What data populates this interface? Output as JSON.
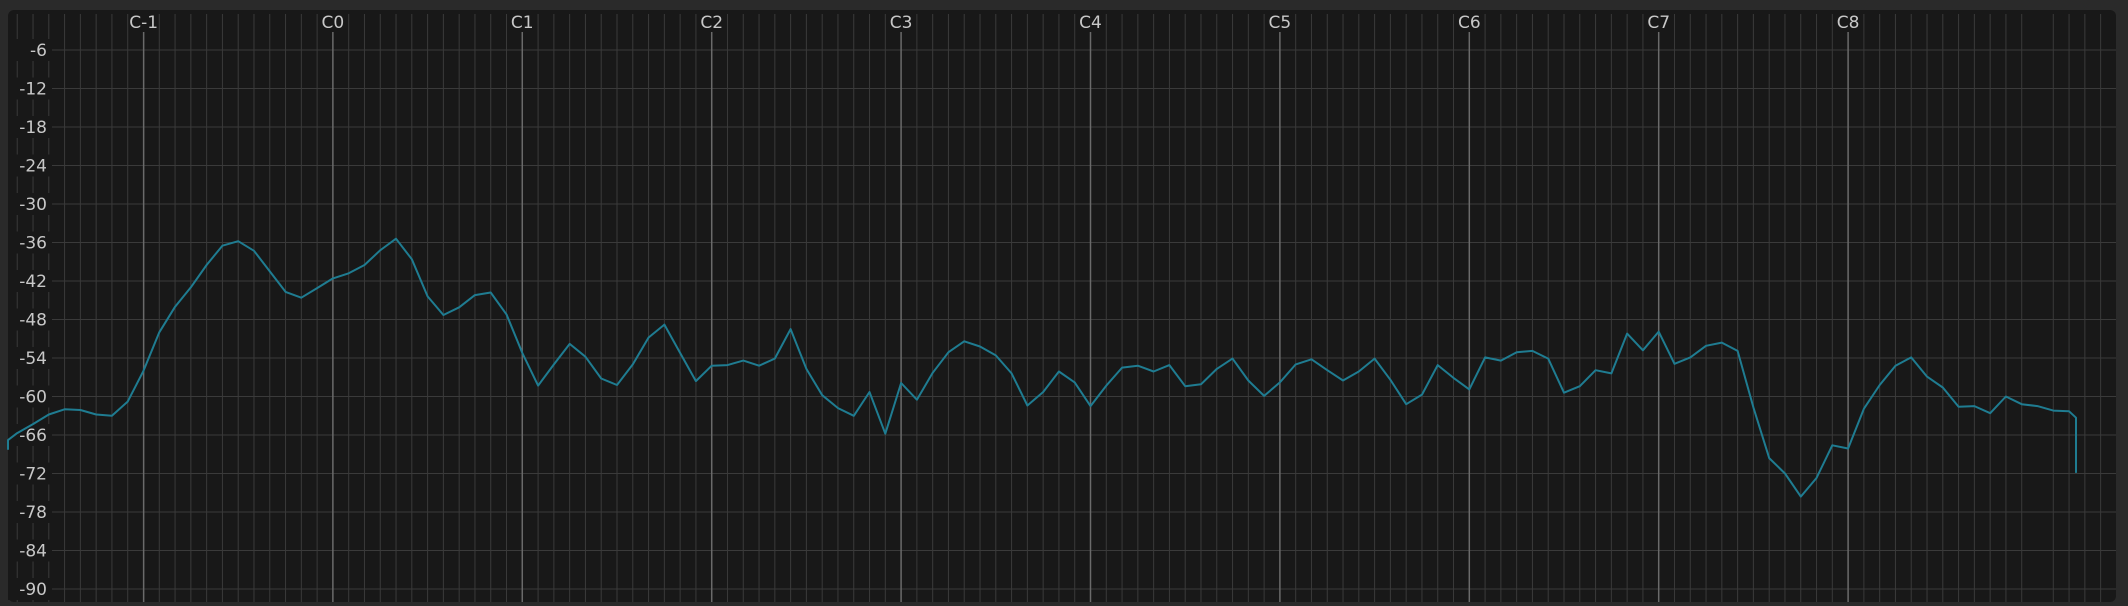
{
  "colors": {
    "frame": "#2a2a2a",
    "plot_background": "#181818",
    "grid_minor": "#3a3a3a",
    "grid_major": "#6a6a6a",
    "label_text": "#c8c8c8",
    "spectrum_line": "#1f7c91"
  },
  "chart_data": {
    "type": "line",
    "title": "",
    "xlabel": "",
    "ylabel": "",
    "x_scale": "log",
    "x_ticks": [
      {
        "label": "C-1",
        "hz": 8.18
      },
      {
        "label": "C0",
        "hz": 16.35
      },
      {
        "label": "C1",
        "hz": 32.7
      },
      {
        "label": "C2",
        "hz": 65.41
      },
      {
        "label": "C3",
        "hz": 130.81
      },
      {
        "label": "C4",
        "hz": 261.63
      },
      {
        "label": "C5",
        "hz": 523.25
      },
      {
        "label": "C6",
        "hz": 1046.5
      },
      {
        "label": "C7",
        "hz": 2093
      },
      {
        "label": "C8",
        "hz": 4186.01
      }
    ],
    "y_ticks": [
      "-6",
      "-12",
      "-18",
      "-24",
      "-30",
      "-36",
      "-42",
      "-48",
      "-54",
      "-60",
      "-66",
      "-72",
      "-78",
      "-84",
      "-90"
    ],
    "y_tick_values": [
      -6,
      -12,
      -18,
      -24,
      -30,
      -36,
      -42,
      -48,
      -54,
      -60,
      -66,
      -72,
      -78,
      -84,
      -90
    ],
    "ylim": [
      -90,
      0
    ],
    "grid": true,
    "series": [
      {
        "values_x_note_index": [
          -13,
          -12,
          -11,
          -10,
          -9,
          -8,
          -7,
          -6,
          -5,
          -4,
          -3,
          -2,
          -1,
          0,
          1,
          2,
          3,
          4,
          5,
          6,
          7,
          8,
          9,
          10,
          11,
          12,
          13,
          14,
          15,
          16,
          17,
          18,
          19,
          20,
          21,
          22,
          23,
          24,
          25,
          26,
          27,
          28,
          29,
          30,
          31,
          32,
          33,
          34,
          35,
          36,
          37,
          38,
          39,
          40,
          41,
          42,
          43,
          44,
          45,
          46,
          47,
          48,
          49,
          50,
          51,
          52,
          53,
          54,
          55,
          56,
          57,
          58,
          59,
          60,
          61,
          62,
          63,
          64,
          65,
          66,
          67,
          68,
          69,
          70,
          71,
          72,
          73,
          74,
          75,
          76,
          77,
          78,
          79,
          80,
          81,
          82,
          83,
          84,
          85,
          86,
          87,
          88,
          89,
          90,
          91,
          92,
          93,
          94,
          95,
          96,
          97,
          98,
          99,
          100,
          101,
          102,
          103,
          104,
          105,
          106,
          107,
          108,
          109,
          110,
          111,
          112,
          113,
          114,
          115,
          116,
          117,
          118,
          119,
          120,
          121,
          122,
          123,
          124,
          125,
          126,
          127,
          128,
          129,
          130,
          131
        ],
        "values_db": [
          -68.3,
          -68.1,
          -67.9,
          -67.5,
          -66.8,
          -65.7,
          -64.3,
          -62.8,
          -62,
          -62.1,
          -62.8,
          -63,
          -60.8,
          -56,
          -50,
          -46,
          -43,
          -39.5,
          -36.5,
          -35.8,
          -37.3,
          -40.5,
          -43.7,
          -44.6,
          -43.1,
          -41.6,
          -40.8,
          -39.5,
          -37.2,
          -35.4,
          -38.6,
          -44.4,
          -47.3,
          -46.1,
          -44.2,
          -43.8,
          -47.2,
          -53.2,
          -58.3,
          -55,
          -51.8,
          -53.8,
          -57.2,
          -58.2,
          -55,
          -50.8,
          -48.8,
          -53.2,
          -57.6,
          -55.2,
          -55.1,
          -54.4,
          -55.2,
          -54.1,
          -49.5,
          -55.7,
          -59.8,
          -61.8,
          -63,
          -59.3,
          -65.8,
          -57.9,
          -60.5,
          -56.3,
          -53.1,
          -51.4,
          -52.2,
          -53.6,
          -56.4,
          -61.4,
          -59.3,
          -56.1,
          -57.8,
          -61.5,
          -58.3,
          -55.5,
          -55.2,
          -56.1,
          -55.1,
          -58.4,
          -58.1,
          -55.7,
          -54.1,
          -57.5,
          -59.9,
          -57.8,
          -55,
          -54.2,
          -55.9,
          -57.5,
          -56.1,
          -54.1,
          -57.4,
          -61.2,
          -59.7,
          -55.1,
          -57.1,
          -58.9,
          -53.9,
          -54.4,
          -53.1,
          -52.9,
          -54.1,
          -59.4,
          -58.4,
          -55.9,
          -56.4,
          -50.2,
          -52.8,
          -49.9,
          -54.9,
          -53.9,
          -52.1,
          -51.6,
          -52.9,
          -61.7,
          -69.6,
          -72,
          -75.6,
          -72.7,
          -67.6,
          -68.1,
          -61.9,
          -58.2,
          -55.2,
          -53.9,
          -56.9,
          -58.6,
          -61.6,
          -61.5,
          -62.6,
          -60,
          -61.2,
          -61.5,
          -62.2,
          -62.3,
          -63.3,
          -68.1,
          -71.9
        ]
      }
    ]
  }
}
